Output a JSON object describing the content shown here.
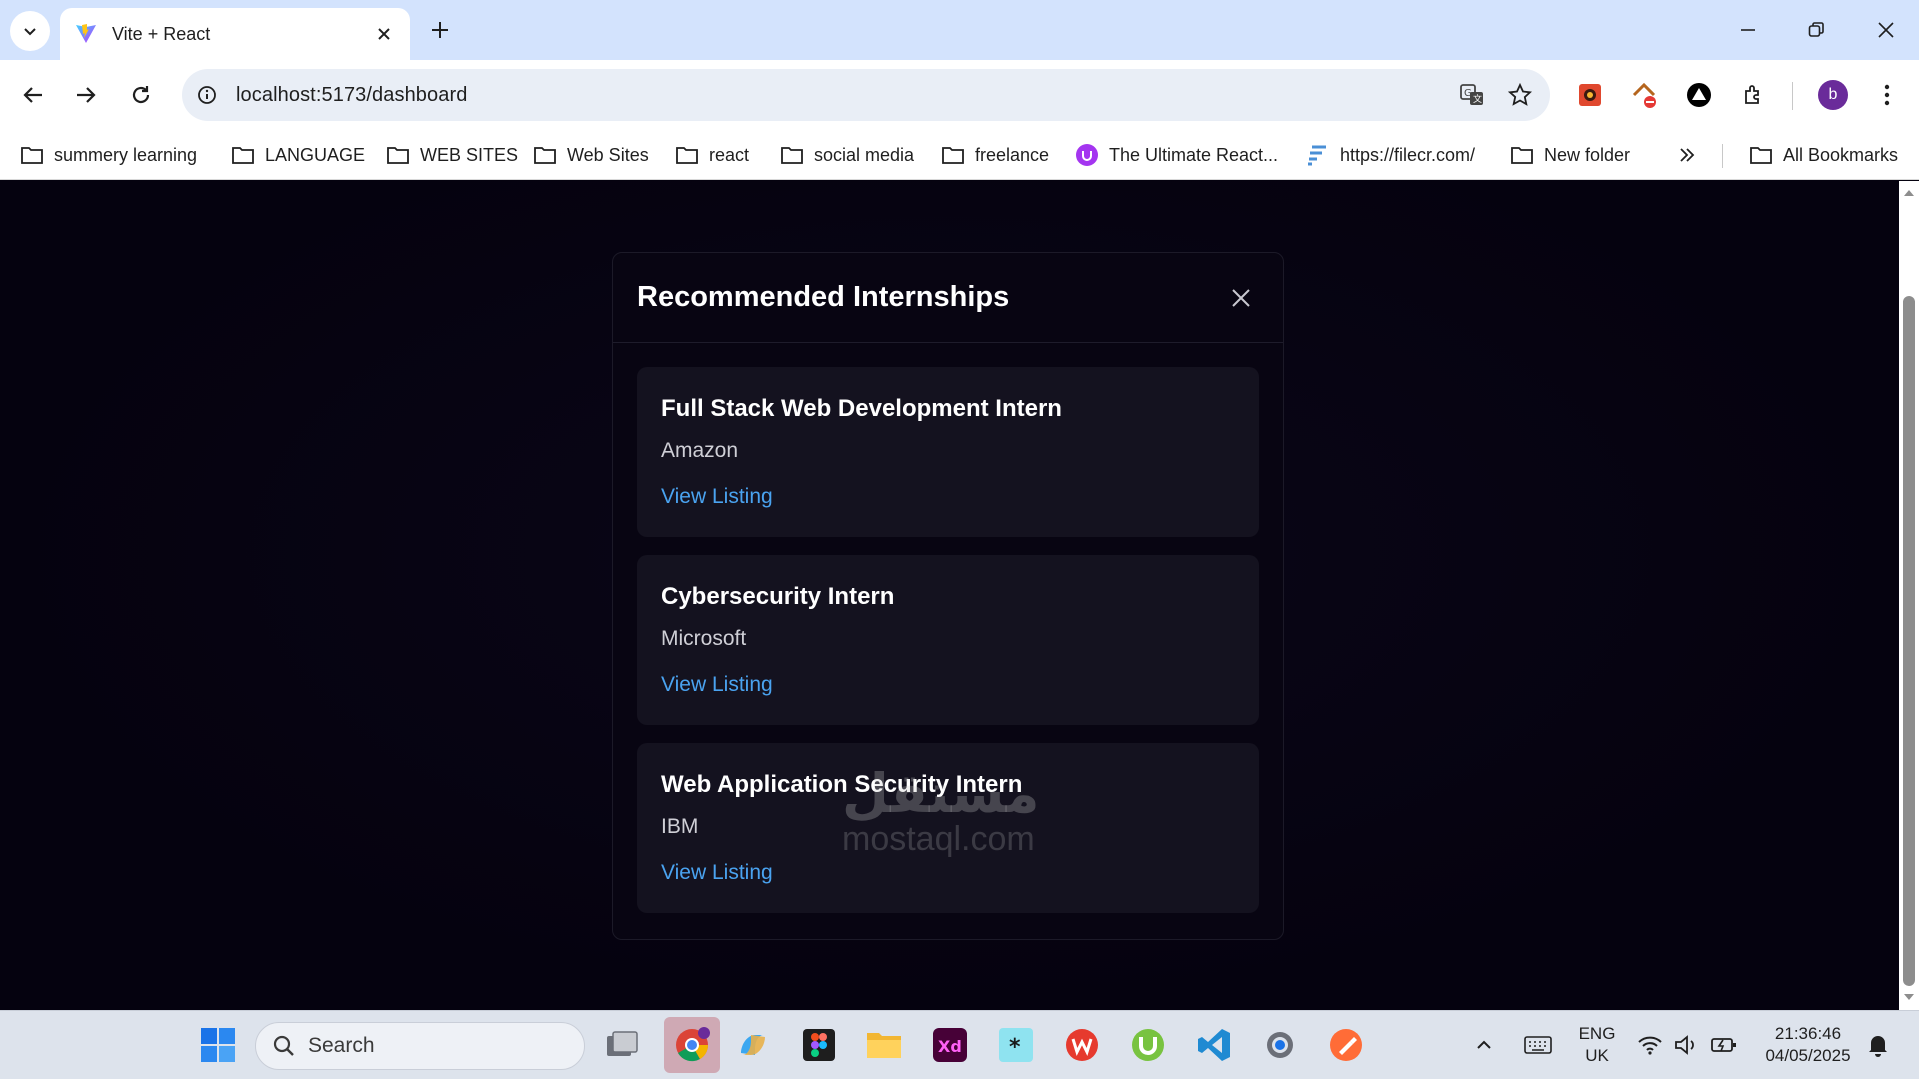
{
  "browser": {
    "tab_title": "Vite + React",
    "url": "localhost:5173/dashboard",
    "profile_initial": "b",
    "bookmarks": [
      {
        "label": "summery learning",
        "icon": "folder-icon"
      },
      {
        "label": "LANGUAGE",
        "icon": "folder-icon"
      },
      {
        "label": "WEB SITES",
        "icon": "folder-icon"
      },
      {
        "label": "Web Sites",
        "icon": "folder-icon"
      },
      {
        "label": "react",
        "icon": "folder-icon"
      },
      {
        "label": "social media",
        "icon": "folder-icon"
      },
      {
        "label": "freelance",
        "icon": "folder-icon"
      },
      {
        "label": "The Ultimate React...",
        "icon": "udemy-icon"
      },
      {
        "label": "https://filecr.com/",
        "icon": "filecr-icon"
      },
      {
        "label": "New folder",
        "icon": "folder-icon"
      }
    ],
    "all_bookmarks_label": "All Bookmarks"
  },
  "modal": {
    "title": "Recommended Internships",
    "listings": [
      {
        "title": "Full Stack Web Development Intern",
        "company": "Amazon",
        "link_label": "View Listing"
      },
      {
        "title": "Cybersecurity Intern",
        "company": "Microsoft",
        "link_label": "View Listing"
      },
      {
        "title": "Web Application Security Intern",
        "company": "IBM",
        "link_label": "View Listing"
      }
    ]
  },
  "watermark": {
    "text": "مستقل",
    "sub": "mostaql.com"
  },
  "taskbar": {
    "search_placeholder": "Search",
    "language_line1": "ENG",
    "language_line2": "UK",
    "time": "21:36:46",
    "date": "04/05/2025"
  },
  "colors": {
    "page_bg": "#05020f",
    "card_bg": "#14121f",
    "link": "#4aa3f0",
    "tabstrip": "#d3e3fd"
  }
}
